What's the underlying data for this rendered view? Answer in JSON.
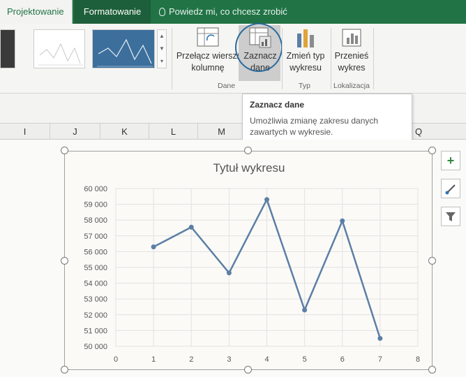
{
  "tabs": {
    "active": "Projektowanie",
    "format": "Formatowanie",
    "tell_me": "Powiedz mi, co chcesz zrobić"
  },
  "ribbon": {
    "switch_label_1": "Przełącz wiersz/",
    "switch_label_2": "kolumnę",
    "select_label_1": "Zaznacz",
    "select_label_2": "dane",
    "change_label_1": "Zmień typ",
    "change_label_2": "wykresu",
    "move_label_1": "Przenieś",
    "move_label_2": "wykres",
    "group_dane": "Dane",
    "group_typ": "Typ",
    "group_lokalizacja": "Lokalizacja"
  },
  "tooltip": {
    "title": "Zaznacz dane",
    "desc_1": "Umożliwia zmianę zakresu danych",
    "desc_2": "zawartych w wykresie."
  },
  "columns": [
    "I",
    "J",
    "K",
    "L",
    "M",
    "Q"
  ],
  "side_buttons": {
    "add": "+"
  },
  "chart_data": {
    "type": "scatter",
    "title": "Tytuł wykresu",
    "x": [
      1,
      2,
      3,
      4,
      5,
      6,
      7
    ],
    "y": [
      56300,
      57550,
      54650,
      59300,
      52300,
      57950,
      50500
    ],
    "xlim": [
      0,
      8
    ],
    "ylim": [
      50000,
      60000
    ],
    "x_ticks": [
      "0",
      "1",
      "2",
      "3",
      "4",
      "5",
      "6",
      "7",
      "8"
    ],
    "y_ticks": [
      "50 000",
      "51 000",
      "52 000",
      "53 000",
      "54 000",
      "55 000",
      "56 000",
      "57 000",
      "58 000",
      "59 000",
      "60 000"
    ],
    "series_color": "#5b7fa6",
    "grid": true
  }
}
